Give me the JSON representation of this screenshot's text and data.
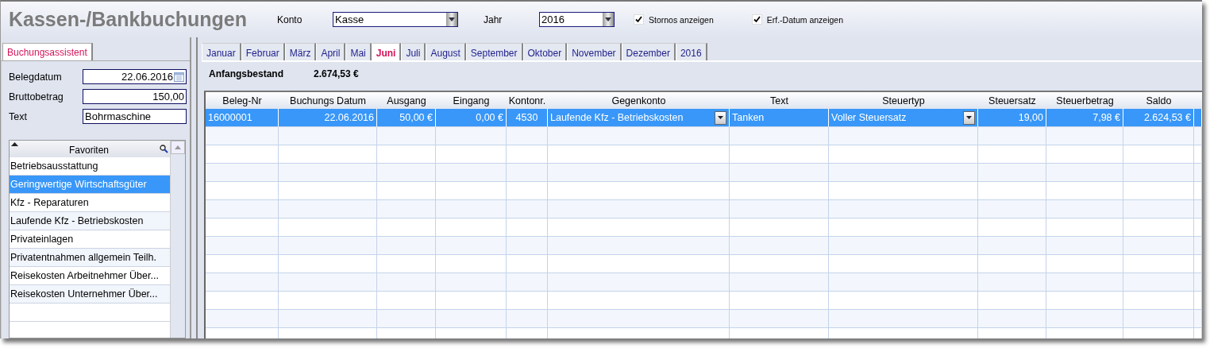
{
  "window": {
    "title": "Kassen-/Bankbuchungen"
  },
  "toolbar": {
    "konto": {
      "label": "Konto",
      "value": "Kasse"
    },
    "jahr": {
      "label": "Jahr",
      "value": "2016"
    },
    "checkboxes": [
      {
        "label": "Stornos anzeigen",
        "checked": true
      },
      {
        "label": "Erf.-Datum anzeigen",
        "checked": true
      }
    ]
  },
  "sidebar": {
    "tab": {
      "label": "Buchungsassistent",
      "selected": true
    },
    "fields": [
      {
        "label": "Belegdatum",
        "value": "22.06.2016",
        "kind": "date"
      },
      {
        "label": "Bruttobetrag",
        "value": "150,00",
        "kind": "number"
      },
      {
        "label": "Text",
        "value": "Bohrmaschine",
        "kind": "text"
      }
    ],
    "favorites": {
      "title": "Favoriten",
      "items": [
        {
          "label": "Betriebsausstattung",
          "selected": false
        },
        {
          "label": "Geringwertige Wirtschaftsgüter",
          "selected": true
        },
        {
          "label": "Kfz - Reparaturen",
          "selected": false
        },
        {
          "label": "Laufende Kfz - Betriebskosten",
          "selected": false
        },
        {
          "label": "Privateinlagen",
          "selected": false
        },
        {
          "label": "Privatentnahmen allgemein Teilh.",
          "selected": false
        },
        {
          "label": "Reisekosten Arbeitnehmer Über...",
          "selected": false
        },
        {
          "label": "Reisekosten Unternehmer Über...",
          "selected": false
        }
      ]
    }
  },
  "tabs": [
    {
      "label": "Januar",
      "selected": false
    },
    {
      "label": "Februar",
      "selected": false
    },
    {
      "label": "März",
      "selected": false
    },
    {
      "label": "April",
      "selected": false
    },
    {
      "label": "Mai",
      "selected": false
    },
    {
      "label": "Juni",
      "selected": true
    },
    {
      "label": "Juli",
      "selected": false
    },
    {
      "label": "August",
      "selected": false
    },
    {
      "label": "September",
      "selected": false
    },
    {
      "label": "Oktober",
      "selected": false
    },
    {
      "label": "November",
      "selected": false
    },
    {
      "label": "Dezember",
      "selected": false
    },
    {
      "label": "2016",
      "selected": false
    }
  ],
  "opening_balance": {
    "label": "Anfangsbestand",
    "value": "2.674,53 €"
  },
  "table": {
    "columns": [
      {
        "label": "Beleg-Nr",
        "kind": "text"
      },
      {
        "label": "Buchungs Datum",
        "kind": "number"
      },
      {
        "label": "Ausgang",
        "kind": "number"
      },
      {
        "label": "Eingang",
        "kind": "number"
      },
      {
        "label": "Kontonr.",
        "kind": "code"
      },
      {
        "label": "Gegenkonto",
        "kind": "dropdown"
      },
      {
        "label": "Text",
        "kind": "text"
      },
      {
        "label": "Steuertyp",
        "kind": "dropdown"
      },
      {
        "label": "Steuersatz",
        "kind": "number"
      },
      {
        "label": "Steuerbetrag",
        "kind": "number"
      },
      {
        "label": "Saldo",
        "kind": "number"
      }
    ],
    "rows": [
      {
        "selected": true,
        "cells": [
          "16000001",
          "22.06.2016",
          "50,00 €",
          "0,00 €",
          "4530",
          "Laufende Kfz - Betriebskosten",
          "Tanken",
          "Voller Steuersatz",
          "19,00",
          "7,98 €",
          "2.624,53 €"
        ]
      }
    ]
  }
}
